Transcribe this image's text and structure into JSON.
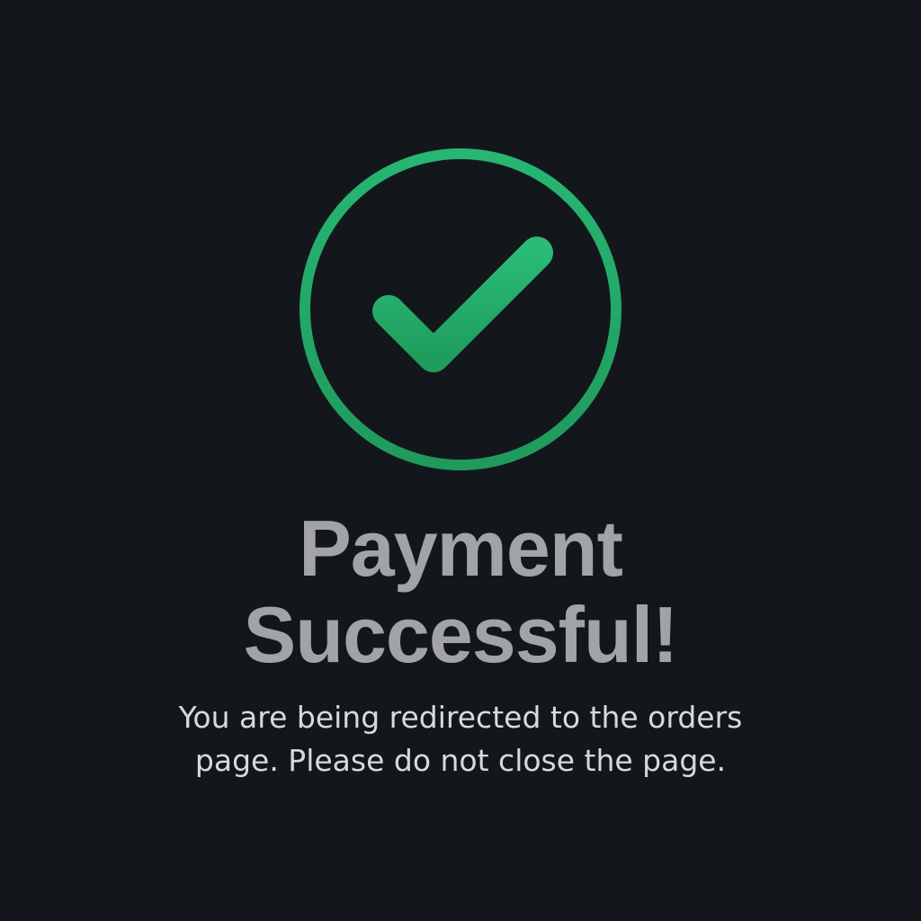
{
  "status": {
    "icon": "checkmark-circle-icon",
    "accent_color": "#27b56f",
    "title_lines": [
      "Payment",
      "Successful!"
    ],
    "message_lines": [
      "You are being redirected to the orders",
      "page. Please do not close the page."
    ]
  },
  "colors": {
    "background": "#13171c",
    "title": "#a1a3a6",
    "message": "#d7d9dc"
  }
}
